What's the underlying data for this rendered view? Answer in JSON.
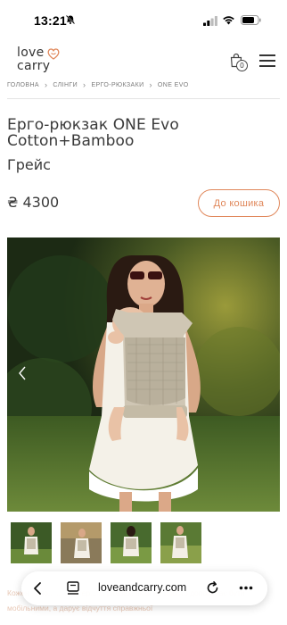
{
  "status_bar": {
    "time": "13:21"
  },
  "header": {
    "logo_line1": "love",
    "logo_line2": "carry",
    "cart_count": "0",
    "accent_color": "#e0875a"
  },
  "breadcrumb": {
    "items": [
      "ГОЛОВНА",
      "СЛІНГИ",
      "ЕРГО-РЮКЗАКИ",
      "ONE EVO"
    ]
  },
  "product": {
    "title": "Ерго-рюкзак ONE Evo Cotton+Bamboo",
    "variant": "Грейс",
    "price": "₴ 4300",
    "add_to_cart_label": "До кошика"
  },
  "gallery": {
    "thumbnail_count": 4
  },
  "description": {
    "text": "Кожен ... по... ... ... ... ер... ... рюкзак, який не просто допомагає бути мобільними, а дарує відчуття справжньої"
  },
  "browser": {
    "url": "loveandcarry.com"
  }
}
